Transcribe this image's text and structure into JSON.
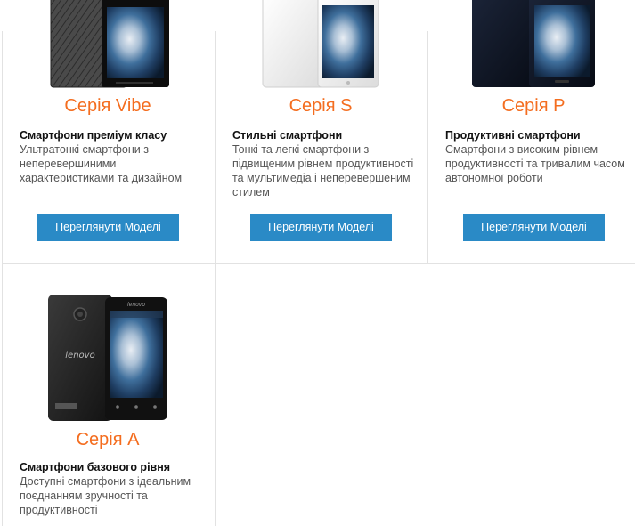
{
  "cards": [
    {
      "series": "Серія Vibe",
      "subtitle": "Смартфони преміум класу",
      "description": "Ультратонкі смартфони з неперевершиними характеристиками та дизайном",
      "button": "Переглянути Моделі"
    },
    {
      "series": "Серія S",
      "subtitle": "Стильні смартфони",
      "description": "Тонкі та легкі смартфони з підвищеним рівнем продуктивності та мультимедіа і неперевершеним стилем",
      "button": "Переглянути Моделі"
    },
    {
      "series": "Серія P",
      "subtitle": "Продуктивні смартфони",
      "description": "Смартфони з високим рівнем продуктивності та тривалим часом автономної роботи",
      "button": "Переглянути Моделі"
    },
    {
      "series": "Серія A",
      "subtitle": "Смартфони базового рівня",
      "description": "Доступні смартфони з ідеальним поєднанням зручності та продуктивності",
      "phone_brand": "lenovo"
    }
  ],
  "colors": {
    "accent_orange": "#f46d1f",
    "button_blue": "#2a8ac6",
    "divider": "#e2e2e2"
  }
}
